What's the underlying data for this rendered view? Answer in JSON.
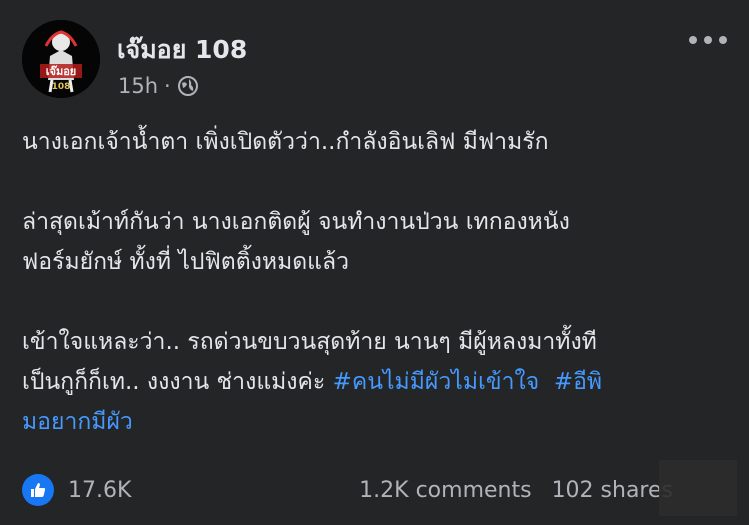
{
  "post": {
    "author": {
      "name": "เจ๊มอย 108",
      "avatar_icon": "jemoy-108-avatar-logo",
      "avatar_text": "เจ๊มอย",
      "avatar_number": "108"
    },
    "meta": {
      "time": "15h",
      "separator": "·",
      "audience_icon": "globe-icon"
    },
    "more_icon": "more-horizontal-icon",
    "body": {
      "p1": {
        "line1": "นางเอกเจ้าน้ำตา เพิ่งเปิดตัวว่า..กำลังอินเลิฟ มีฟามรัก"
      },
      "p2": {
        "line1": "ล่าสุดเม้าท์กันว่า นางเอกติดผู้ จนทำงานป่วน เทกองหนัง",
        "line2": "ฟอร์มยักษ์ ทั้งที่ ไปฟิตติ้งหมดแล้ว"
      },
      "p3": {
        "line1": "เข้าใจแหละว่า.. รถด่วนขบวนสุดท้าย นานๆ มีผู้หลงมาทั้งที",
        "line2_text": "เป็นกูก็ก็เท.. งงงาน ช่างแม่งค่ะ ",
        "hashtag1": "#คนไม่มีผัวไม่เข้าใจ",
        "hashtag2_part1": "#อีพิ",
        "hashtag2_part2": "มอยากมีผัว"
      }
    },
    "footer": {
      "like_icon": "thumbs-up-icon",
      "reactions": "17.6K",
      "comments": "1.2K comments",
      "shares": "102 shares"
    },
    "colors": {
      "background": "#242526",
      "text_primary": "#e4e6eb",
      "text_secondary": "#b0b3b8",
      "hashtag": "#4599ff",
      "like_blue": "#1877f2"
    }
  }
}
